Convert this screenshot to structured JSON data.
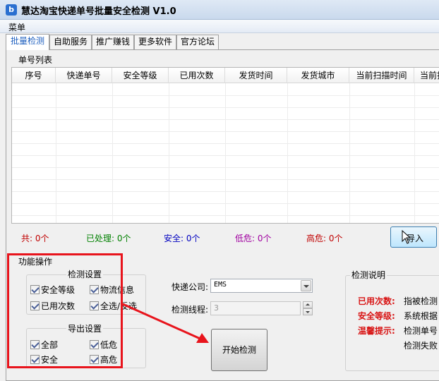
{
  "window": {
    "title": "慧达淘宝快递单号批量安全检测 V1.0",
    "icon": "app-logo-icon"
  },
  "menu": {
    "items": [
      "菜单"
    ]
  },
  "tabs": [
    {
      "label": "批量检测",
      "active": true
    },
    {
      "label": "自助服务"
    },
    {
      "label": "推广赚钱"
    },
    {
      "label": "更多软件"
    },
    {
      "label": "官方论坛"
    }
  ],
  "list": {
    "group_title": "单号列表",
    "columns": [
      "序号",
      "快递单号",
      "安全等级",
      "已用次数",
      "发货时间",
      "发货城市",
      "当前扫描时间",
      "当前扫"
    ]
  },
  "status": {
    "total": "共: 0个",
    "processed": "已处理: 0个",
    "safe": "安全: 0个",
    "low_risk": "低危: 0个",
    "high_risk": "高危: 0个",
    "colors": {
      "total": "#c00000",
      "processed": "#008000",
      "safe": "#0000c0",
      "low_risk": "#a000a0",
      "high_risk": "#c00000"
    }
  },
  "import_button": {
    "label": "导入"
  },
  "function_panel": {
    "title": "功能操作",
    "detect_settings": {
      "title": "检测设置",
      "options": [
        {
          "label": "安全等级",
          "checked": true
        },
        {
          "label": "物流信息",
          "checked": true
        },
        {
          "label": "已用次数",
          "checked": true
        },
        {
          "label": "全选/反选",
          "checked": true
        }
      ]
    },
    "export_settings": {
      "title": "导出设置",
      "options": [
        {
          "label": "全部",
          "checked": true
        },
        {
          "label": "低危",
          "checked": true
        },
        {
          "label": "安全",
          "checked": true
        },
        {
          "label": "高危",
          "checked": true
        }
      ]
    }
  },
  "courier": {
    "label": "快递公司:",
    "value": "EMS"
  },
  "threads": {
    "label": "检测线程:",
    "value": "3"
  },
  "start_button": {
    "label": "开始检测"
  },
  "explanation": {
    "title": "检测说明",
    "lines": [
      {
        "key": "已用次数:",
        "text": "指被检测"
      },
      {
        "key": "安全等级:",
        "text": "系统根据"
      },
      {
        "key": "温馨提示:",
        "text": "检测单号"
      },
      {
        "key": "",
        "text": "检测失败"
      }
    ]
  },
  "annotation_colors": {
    "highlight": "#e8141c"
  }
}
